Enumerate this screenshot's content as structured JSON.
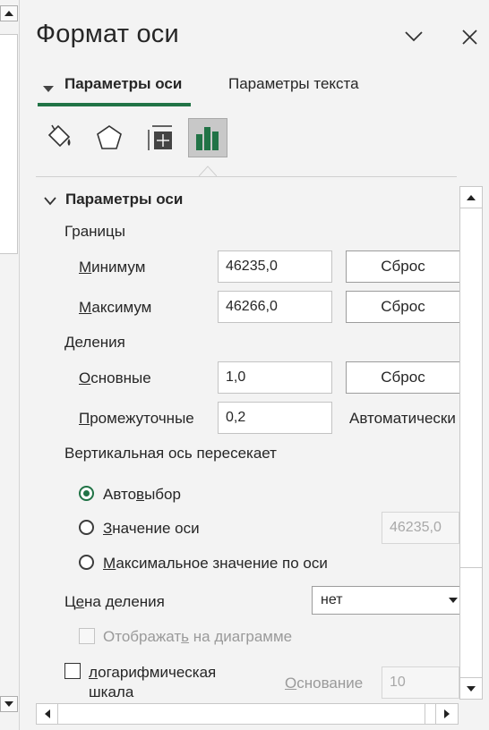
{
  "pane": {
    "title": "Формат оси",
    "tabs": [
      {
        "label": "Параметры оси",
        "active": true
      },
      {
        "label": "Параметры текста",
        "active": false
      }
    ]
  },
  "section": {
    "title": "Параметры оси",
    "bounds": {
      "heading": "Границы",
      "min": {
        "label_u": "М",
        "label_rest": "инимум",
        "value": "46235,0",
        "reset": "Сброс"
      },
      "max": {
        "label_u": "М",
        "label_rest": "аксимум",
        "value": "46266,0",
        "reset": "Сброс"
      }
    },
    "units": {
      "heading": "Деления",
      "major": {
        "label_u": "О",
        "label_rest": "сновные",
        "value": "1,0",
        "reset": "Сброс"
      },
      "minor": {
        "label_u": "П",
        "label_rest": "ромежуточные",
        "value": "0,2",
        "auto": "Автоматически"
      }
    },
    "crosses": {
      "heading": "Вертикальная ось пересекает",
      "auto": {
        "pre": "Авто",
        "u": "в",
        "post": "ыбор"
      },
      "value": {
        "u": "З",
        "post": "начение оси",
        "field": "46235,0"
      },
      "max": {
        "u": "М",
        "post": "аксимальное значение по оси"
      }
    },
    "display_units": {
      "label_pre": "Ц",
      "label_u": "е",
      "label_post": "на деления",
      "selected": "нет",
      "show_pre": "Отображат",
      "show_u": "ь",
      "show_post": " на диаграмме"
    },
    "log": {
      "label_u": "л",
      "label_rest": "огарифмическая",
      "label_line2": "шкала",
      "base_u": "О",
      "base_rest": "снование",
      "base_value": "10"
    }
  }
}
